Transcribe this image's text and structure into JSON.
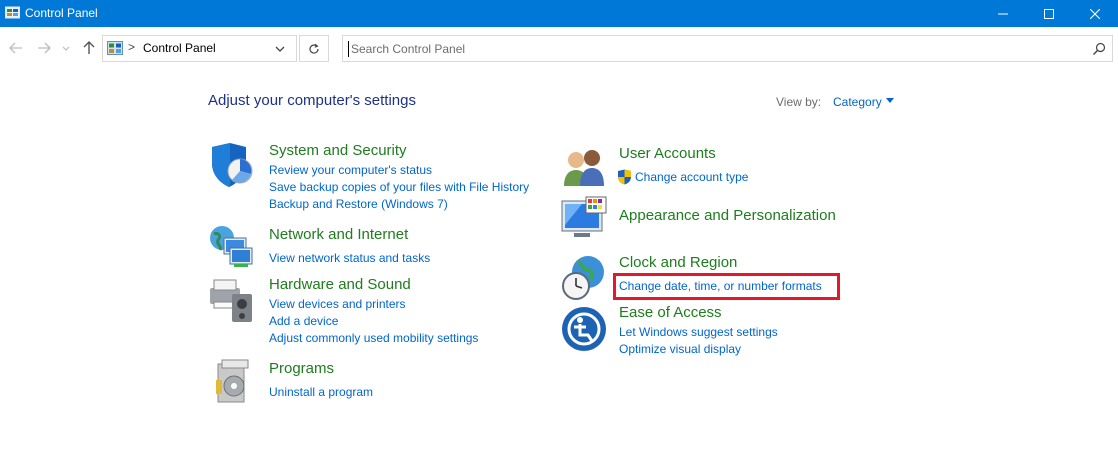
{
  "window": {
    "title": "Control Panel",
    "controls": {
      "minimize": "minimize",
      "maximize": "maximize",
      "close": "close"
    }
  },
  "nav": {
    "address": {
      "separator": ">",
      "location": "Control Panel"
    },
    "search": {
      "placeholder": "Search Control Panel"
    }
  },
  "content": {
    "heading": "Adjust your computer's settings",
    "view_by": {
      "label": "View by:",
      "value": "Category"
    },
    "categories": [
      {
        "title": "System and Security",
        "icon": "system-security-icon",
        "links": [
          "Review your computer's status",
          "Save backup copies of your files with File History",
          "Backup and Restore (Windows 7)"
        ]
      },
      {
        "title": "Network and Internet",
        "icon": "network-icon",
        "links": [
          "View network status and tasks"
        ]
      },
      {
        "title": "Hardware and Sound",
        "icon": "hardware-sound-icon",
        "links": [
          "View devices and printers",
          "Add a device",
          "Adjust commonly used mobility settings"
        ]
      },
      {
        "title": "Programs",
        "icon": "programs-icon",
        "links": [
          "Uninstall a program"
        ]
      },
      {
        "title": "User Accounts",
        "icon": "user-accounts-icon",
        "links": [
          "Change account type"
        ]
      },
      {
        "title": "Appearance and Personalization",
        "icon": "appearance-icon",
        "links": []
      },
      {
        "title": "Clock and Region",
        "icon": "clock-region-icon",
        "links": [
          "Change date, time, or number formats"
        ]
      },
      {
        "title": "Ease of Access",
        "icon": "ease-of-access-icon",
        "links": [
          "Let Windows suggest settings",
          "Optimize visual display"
        ]
      }
    ]
  },
  "colors": {
    "titlebar": "#0078d7",
    "category_title": "#1e7d1e",
    "link": "#0066cc",
    "heading": "#1e3287",
    "highlight": "#e3182d"
  }
}
